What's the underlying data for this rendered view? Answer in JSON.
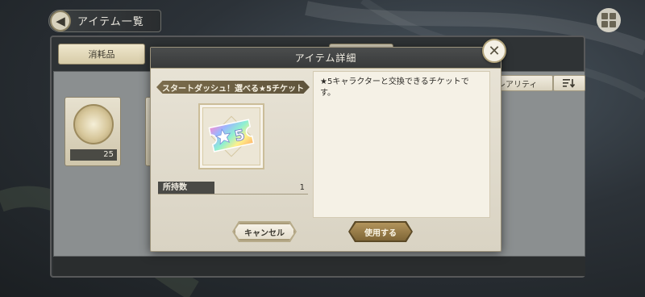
{
  "header": {
    "title": "アイテム一覧",
    "back_icon": "arrow-left-icon",
    "menu_icon": "grid-menu-icon"
  },
  "tabs": {
    "consumable": "消耗品"
  },
  "sort": {
    "rarity": "レアリティ",
    "order_icon": "sort-order-icon"
  },
  "inventory": {
    "items": [
      {
        "qty": "25"
      }
    ]
  },
  "modal": {
    "title": "アイテム詳細",
    "item_name": "スタートダッシュ！選べる★5チケット",
    "ticket_label": "5",
    "owned_label": "所持数",
    "owned_value": "1",
    "description": "★5キャラクターと交換できるチケットです。",
    "cancel_label": "キャンセル",
    "use_label": "使用する",
    "close_icon": "close-icon"
  },
  "colors": {
    "accent_gold": "#9b7d44",
    "header_dark": "#3f4142",
    "panel_cream": "#e9e4d7"
  }
}
